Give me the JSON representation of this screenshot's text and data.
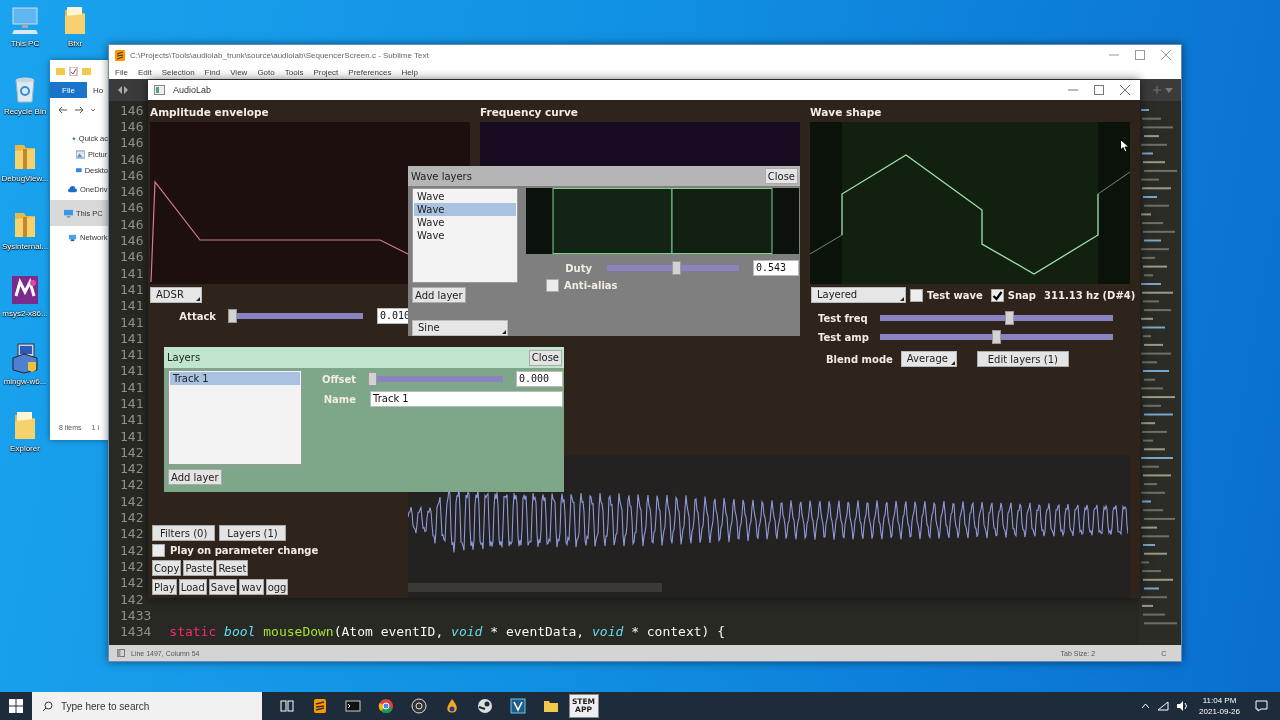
{
  "desktop_icons": [
    {
      "label": "This PC",
      "kind": "computer"
    },
    {
      "label": "Bfxr",
      "kind": "folder"
    },
    {
      "label": "Recycle Bin",
      "kind": "recycle-bin"
    },
    {
      "label": "DebugView...",
      "kind": "zip"
    },
    {
      "label": "Sysinternal...",
      "kind": "zip"
    },
    {
      "label": "msys2-x86...",
      "kind": "msys"
    },
    {
      "label": "mingw-w6...",
      "kind": "installer"
    },
    {
      "label": "Explorer",
      "kind": "folder"
    }
  ],
  "explorer": {
    "ribbon_tabs": [
      {
        "label": "File",
        "selected": true
      },
      {
        "label": "Ho",
        "selected": false
      }
    ],
    "nav_items": [
      {
        "label": "Quick ac",
        "kind": "star",
        "selected": false
      },
      {
        "label": "Pictur",
        "kind": "pictures",
        "selected": false
      },
      {
        "label": "Deskto",
        "kind": "desktop",
        "selected": false
      },
      {
        "label": "OneDriv",
        "kind": "cloud",
        "selected": false
      },
      {
        "label": "This PC",
        "kind": "computer",
        "selected": true
      },
      {
        "label": "Network",
        "kind": "network",
        "selected": false
      }
    ],
    "status": [
      "8 items",
      "1 i"
    ]
  },
  "editor": {
    "title": "C:\\Projects\\Tools\\audiolab_trunk\\source\\audiolab\\SequencerScreen.c - Sublime Text",
    "menu": [
      "File",
      "Edit",
      "Selection",
      "Find",
      "View",
      "Goto",
      "Tools",
      "Project",
      "Preferences",
      "Help"
    ],
    "line_numbers": [
      "146",
      "146",
      "146",
      "146",
      "146",
      "146",
      "146",
      "146",
      "146",
      "146",
      "141",
      "141",
      "141",
      "141",
      "141",
      "141",
      "141",
      "141",
      "141",
      "141",
      "141",
      "142",
      "142",
      "142",
      "142",
      "142",
      "142",
      "142",
      "142",
      "142",
      "142"
    ],
    "code_lines": [
      {
        "number": "1433"
      },
      {
        "number": "1434",
        "tokens": [
          {
            "text": "static",
            "kind": "keyword"
          },
          {
            "text": " bool",
            "kind": "type"
          },
          {
            "text": " mouseDown",
            "kind": "function"
          },
          {
            "text": "(Atom eventID,",
            "kind": "plain"
          },
          {
            "text": " void",
            "kind": "type"
          },
          {
            "text": " * eventData,",
            "kind": "plain"
          },
          {
            "text": " void",
            "kind": "type"
          },
          {
            "text": " * context) {",
            "kind": "plain"
          }
        ]
      }
    ],
    "status_bar": {
      "position": "Line 1497, Column 54",
      "tab_size": "Tab Size: 2",
      "syntax": "C"
    }
  },
  "audiolab": {
    "title": "AudioLab",
    "amplitude": {
      "title": "Amplitude envelope",
      "mode": "ADSR",
      "params": [
        {
          "label": "Attack",
          "level": 0,
          "value": "0.010"
        }
      ]
    },
    "frequency": {
      "title": "Frequency curve"
    },
    "wave_shape": {
      "title": "Wave shape",
      "mode": "Layered",
      "test_wave": {
        "label": "Test wave",
        "checked": false
      },
      "snap": {
        "label": "Snap",
        "checked": true
      },
      "pitch": "311.13 hz (D#4)",
      "sliders": [
        {
          "label": "Test freq",
          "level": 0.56
        },
        {
          "label": "Test amp",
          "level": 0.5
        }
      ],
      "blend_label": "Blend mode",
      "blend_mode": "Average",
      "edit_button": "Edit layers (1)"
    },
    "controls": {
      "panels": [
        "Filters (0)",
        "Layers (1)"
      ],
      "play_on_change": {
        "label": "Play on parameter change",
        "checked": false
      },
      "edit_buttons": [
        "Copy",
        "Paste",
        "Reset"
      ],
      "file_buttons": [
        "Play",
        "Load",
        "Save",
        "wav",
        "ogg"
      ]
    },
    "wave_layers_dialog": {
      "title": "Wave layers",
      "close": "Close",
      "layers": [
        {
          "label": "Wave",
          "selected": false
        },
        {
          "label": "Wave",
          "selected": true
        },
        {
          "label": "Wave",
          "selected": false
        },
        {
          "label": "Wave",
          "selected": false
        }
      ],
      "add_button": "Add layer",
      "duty": {
        "label": "Duty",
        "level": 0.53,
        "value": "0.543"
      },
      "anti_alias": {
        "label": "Anti-alias",
        "checked": false
      },
      "wave_type": "Sine"
    },
    "layers_dialog": {
      "title": "Layers",
      "close": "Close",
      "tracks": [
        {
          "label": "Track 1",
          "selected": true
        }
      ],
      "add_button": "Add layer",
      "offset": {
        "label": "Offset",
        "level": 0,
        "value": "0.000"
      },
      "name": {
        "label": "Name",
        "value": "Track 1"
      }
    }
  },
  "taskbar": {
    "search_placeholder": "Type here to search",
    "app_label": "STEM APP",
    "time": "11:04 PM",
    "date": "2021-09-26"
  }
}
